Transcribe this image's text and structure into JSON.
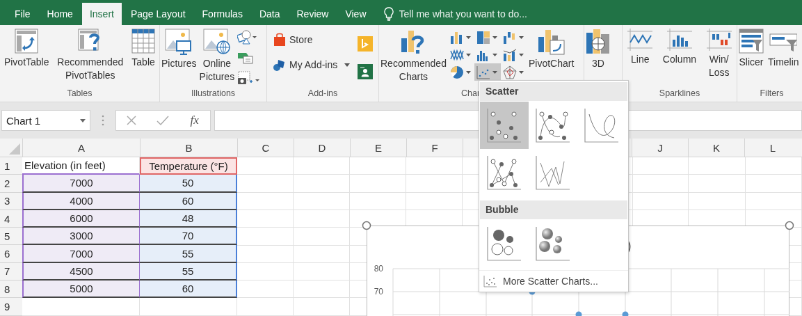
{
  "tabs": [
    {
      "label": "File",
      "selected": false
    },
    {
      "label": "Home",
      "selected": false
    },
    {
      "label": "Insert",
      "selected": true
    },
    {
      "label": "Page Layout",
      "selected": false
    },
    {
      "label": "Formulas",
      "selected": false
    },
    {
      "label": "Data",
      "selected": false
    },
    {
      "label": "Review",
      "selected": false
    },
    {
      "label": "View",
      "selected": false
    }
  ],
  "tell_me": {
    "placeholder": "Tell me what you want to do..."
  },
  "ribbon": [
    {
      "label": "Tables",
      "buttons": [
        "PivotTable",
        "Recommended\nPivotTables",
        "Table"
      ]
    },
    {
      "label": "Illustrations",
      "buttons": [
        "Pictures",
        "Online\nPictures"
      ]
    },
    {
      "label": "Add-ins",
      "buttons": [
        "Store",
        "My Add-ins"
      ]
    },
    {
      "label": "Char",
      "buttons": [
        "Recommended\nCharts",
        "PivotChart"
      ],
      "chart_types": [
        {
          "selected": false
        },
        {
          "selected": false
        },
        {
          "selected": false
        },
        {
          "selected": false
        },
        {
          "selected": false
        },
        {
          "selected": false
        },
        {
          "selected": false
        },
        {
          "selected": true
        },
        {
          "selected": false
        }
      ]
    },
    {
      "buttons": [
        "3D"
      ]
    },
    {
      "label": "Sparklines",
      "buttons": [
        "Line",
        "Column",
        "Win/\nLoss"
      ]
    },
    {
      "label": "Filters",
      "buttons": [
        "Slicer",
        "Timelin"
      ]
    }
  ],
  "name_box": {
    "value": "Chart 1"
  },
  "formula_bar": {
    "fx": "fx"
  },
  "sheet": {
    "columns_left": [
      "A",
      "B",
      "C",
      "D",
      "E",
      "F"
    ],
    "columns_right": [
      "J",
      "K",
      "L"
    ],
    "rows": [
      {
        "num": "1",
        "cells": [
          "Elevation (in feet)",
          "Temperature (°F)"
        ]
      },
      {
        "num": "2",
        "cells": [
          "7000",
          "50"
        ]
      },
      {
        "num": "3",
        "cells": [
          "4000",
          "60"
        ]
      },
      {
        "num": "4",
        "cells": [
          "6000",
          "48"
        ]
      },
      {
        "num": "5",
        "cells": [
          "3000",
          "70"
        ]
      },
      {
        "num": "6",
        "cells": [
          "7000",
          "55"
        ]
      },
      {
        "num": "7",
        "cells": [
          "4500",
          "55"
        ]
      },
      {
        "num": "8",
        "cells": [
          "5000",
          "60"
        ]
      },
      {
        "num": "9"
      }
    ]
  },
  "chart": {
    "title_fragment": ")",
    "y_tick_labels": [
      "80",
      "70"
    ]
  },
  "dropdown": {
    "sections": [
      {
        "title": "Scatter",
        "options": [
          {
            "kind": "markers",
            "selected": true
          },
          {
            "kind": "smooth-markers",
            "selected": false
          },
          {
            "kind": "smooth",
            "selected": false
          },
          {
            "kind": "straight-markers",
            "selected": false
          },
          {
            "kind": "straight",
            "selected": false
          }
        ]
      },
      {
        "title": "Bubble",
        "options": [
          {
            "kind": "bubble",
            "selected": false
          },
          {
            "kind": "bubble-3d",
            "selected": false
          }
        ]
      }
    ],
    "more": "More Scatter Charts..."
  }
}
